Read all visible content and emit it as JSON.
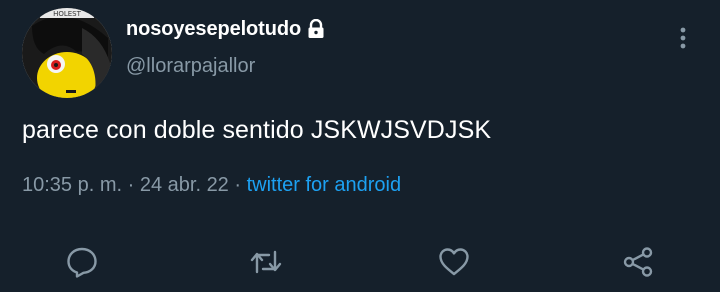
{
  "tweet": {
    "display_name": "nosoyesepelotudo",
    "handle": "@llorarpajallor",
    "protected": true,
    "text": "parece con doble sentido JSKWJSVDJSK",
    "time": "10:35 p. m.",
    "date": "24 abr. 22",
    "separator": "·",
    "source": "twitter for android",
    "avatar_text": "HOLEST"
  },
  "icons": {
    "lock": "lock-icon",
    "more": "more-vertical-icon",
    "reply": "reply-icon",
    "retweet": "retweet-icon",
    "like": "like-icon",
    "share": "share-icon"
  },
  "colors": {
    "background": "#15202b",
    "text": "#ffffff",
    "secondary": "#8899a6",
    "link": "#1da1f2"
  }
}
